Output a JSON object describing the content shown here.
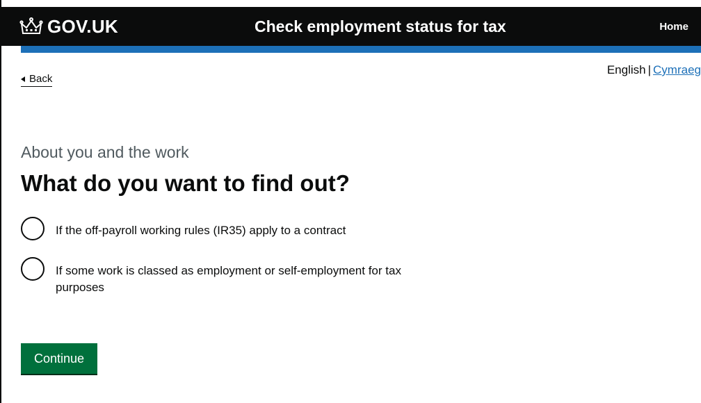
{
  "header": {
    "logo_text": "GOV.UK",
    "service_name": "Check employment status for tax",
    "home_label": "Home"
  },
  "nav": {
    "back_label": "Back"
  },
  "language": {
    "current": "English",
    "separator": "|",
    "alternate": "Cymraeg"
  },
  "question": {
    "caption": "About you and the work",
    "heading": "What do you want to find out?",
    "options": [
      {
        "label": "If the off-payroll working rules (IR35) apply to a contract",
        "selected": false
      },
      {
        "label": "If some work is classed as employment or self-employment for tax purposes",
        "selected": false
      }
    ]
  },
  "actions": {
    "continue_label": "Continue"
  },
  "colors": {
    "header_bg": "#0b0c0c",
    "accent_blue": "#1d70b8",
    "button_green": "#00703c",
    "caption_grey": "#505a5f",
    "link_blue": "#1d70b8"
  },
  "icons": {
    "logo": "crown-icon",
    "back": "triangle-left-icon"
  }
}
